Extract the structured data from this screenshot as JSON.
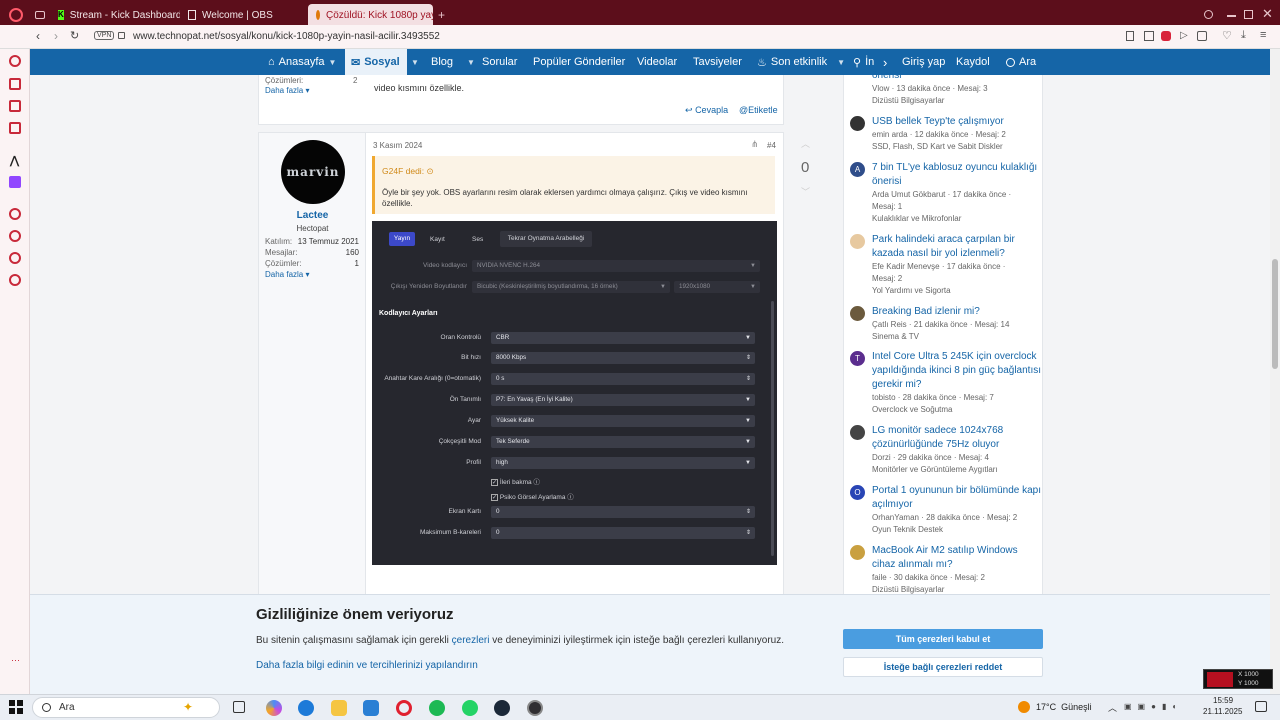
{
  "browser": {
    "tabs": [
      {
        "label": "Stream - Kick Dashboard",
        "icon": "kick-icon"
      },
      {
        "label": "Welcome | OBS",
        "icon": "page-icon"
      },
      {
        "label": "Çözüldü: Kick 1080p yayı",
        "icon": "technopat-icon"
      }
    ],
    "url": "www.technopat.net/sosyal/konu/kick-1080p-yayin-nasil-acilir.3493552",
    "vpn_label": "VPN"
  },
  "nav": {
    "items": [
      "Anasayfa",
      "Sosyal",
      "Blog",
      "Sorular",
      "Popüler Gönderiler",
      "Videolar",
      "Tavsiyeler",
      "Son etkinlik",
      "İn"
    ],
    "login": "Giriş yap",
    "register": "Kaydol",
    "search": "Ara"
  },
  "prev_post": {
    "solutions_label": "Çözümleri:",
    "solutions_value": "2",
    "more_label": "Daha fazla",
    "text": "video kısmını özellikle.",
    "reply_label": "Cevapla",
    "tag_label": "Etiketle"
  },
  "post": {
    "date": "3 Kasım 2024",
    "number": "#4",
    "votes": "0",
    "user": {
      "name": "Lactee",
      "rank": "Hectopat",
      "avatar_text": "marvin"
    },
    "stats": [
      {
        "label": "Katılım:",
        "value": "13 Temmuz 2021"
      },
      {
        "label": "Mesajlar:",
        "value": "160"
      },
      {
        "label": "Çözümler:",
        "value": "1"
      }
    ],
    "more_label": "Daha fazla",
    "quote": {
      "author": "G24F dedi:",
      "text": "Öyle bir şey yok. OBS ayarlarını resim olarak eklersen yardımcı olmaya çalışırız. Çıkış ve video kısmını özellikle."
    }
  },
  "obs": {
    "tabs": [
      "Yayın",
      "Kayıt",
      "Ses",
      "Tekrar Oynatma Arabelleği"
    ],
    "encoder_label": "Video kodlayıcı",
    "encoder_value": "NVIDIA NVENC H.264",
    "rescale_label": "Çıkışı Yeniden Boyutlandır",
    "rescale_value": "Bicubic (Keskinleştirilmiş boyutlandırma, 16 örnek)",
    "resolution_value": "1920x1080",
    "section_title": "Kodlayıcı Ayarları",
    "fields": [
      {
        "label": "Oran Kontrolü",
        "value": "CBR"
      },
      {
        "label": "Bit hızı",
        "value": "8000 Kbps"
      },
      {
        "label": "Anahtar Kare Aralığı (0=otomatik)",
        "value": "0 s"
      },
      {
        "label": "Ön Tanımlı",
        "value": "P7: En Yavaş (En İyi Kalite)"
      },
      {
        "label": "Ayar",
        "value": "Yüksek Kalite"
      },
      {
        "label": "Çokçeşitli Mod",
        "value": "Tek Seferde"
      },
      {
        "label": "Profil",
        "value": "high"
      }
    ],
    "checks": [
      "İleri bakma",
      "Psiko Görsel Ayarlama"
    ],
    "fields2": [
      {
        "label": "Ekran Kartı",
        "value": "0"
      },
      {
        "label": "Maksimum B-kareleri",
        "value": "0"
      }
    ]
  },
  "sidebar_items": [
    {
      "title": "önerisi",
      "meta1": "Vlow · 13 dakika önce · Mesaj: 3",
      "meta2": "Dizüstü Bilgisayarlar",
      "avatar": ""
    },
    {
      "title": "USB bellek Teyp'te çalışmıyor",
      "meta1": "emin arda · 12 dakika önce · Mesaj: 2",
      "meta2": "SSD, Flash, SD Kart ve Sabit Diskler",
      "avatar": ""
    },
    {
      "title": "7 bin TL'ye kablosuz oyuncu kulaklığı önerisi",
      "meta1": "Arda Umut Gökbarut · 17 dakika önce ·",
      "meta2": "Mesaj: 1",
      "meta3": "Kulaklıklar ve Mikrofonlar",
      "avatar": "A"
    },
    {
      "title": "Park halindeki araca çarpılan bir kazada nasıl bir yol izlenmeli?",
      "meta1": "Efe Kadir Menevşe · 17 dakika önce ·",
      "meta2": "Mesaj: 2",
      "meta3": "Yol Yardımı ve Sigorta",
      "avatar": ""
    },
    {
      "title": "Breaking Bad izlenir mi?",
      "meta1": "Çatlı Reis · 21 dakika önce · Mesaj: 14",
      "meta2": "Sinema & TV",
      "avatar": ""
    },
    {
      "title": "Intel Core Ultra 5 245K için overclock yapıldığında ikinci 8 pin güç bağlantısı gerekir mi?",
      "meta1": "tobisto · 28 dakika önce · Mesaj: 7",
      "meta2": "Overclock ve Soğutma",
      "avatar": "T"
    },
    {
      "title": "LG monitör sadece 1024x768 çözünürlüğünde 75Hz oluyor",
      "meta1": "Dorzi · 29 dakika önce · Mesaj: 4",
      "meta2": "Monitörler ve Görüntüleme Aygıtları",
      "avatar": ""
    },
    {
      "title": "Portal 1 oyununun bir bölümünde kapı açılmıyor",
      "meta1": "OrhanYaman · 28 dakika önce · Mesaj: 2",
      "meta2": "Oyun Teknik Destek",
      "avatar": "O"
    },
    {
      "title": "MacBook Air M2 satılıp Windows cihaz alınmalı mı?",
      "meta1": "faile · 30 dakika önce · Mesaj: 2",
      "meta2": "Dizüstü Bilgisayarlar",
      "avatar": ""
    }
  ],
  "cookie": {
    "title": "Gizliliğinize önem veriyoruz",
    "text_before": "Bu sitenin çalışmasını sağlamak için gerekli",
    "text_link": "çerezleri",
    "text_after": "ve deneyiminizi iyileştirmek için isteğe bağlı çerezleri kullanıyoruz.",
    "more_link": "Daha fazla bilgi edinin ve tercihlerinizi yapılandırın",
    "accept": "Tüm çerezleri kabul et",
    "reject": "İsteğe bağlı çerezleri reddet"
  },
  "overlay": {
    "x_label": "X 1000",
    "y_label": "Y 1000"
  },
  "taskbar": {
    "search": "Ara",
    "weather": "17°C  Güneşli",
    "time": "15:59",
    "date": "21.11.2025"
  },
  "colors": {
    "brand": "#1565a7",
    "browser": "#5c0e1b",
    "accent": "#c8293a"
  }
}
